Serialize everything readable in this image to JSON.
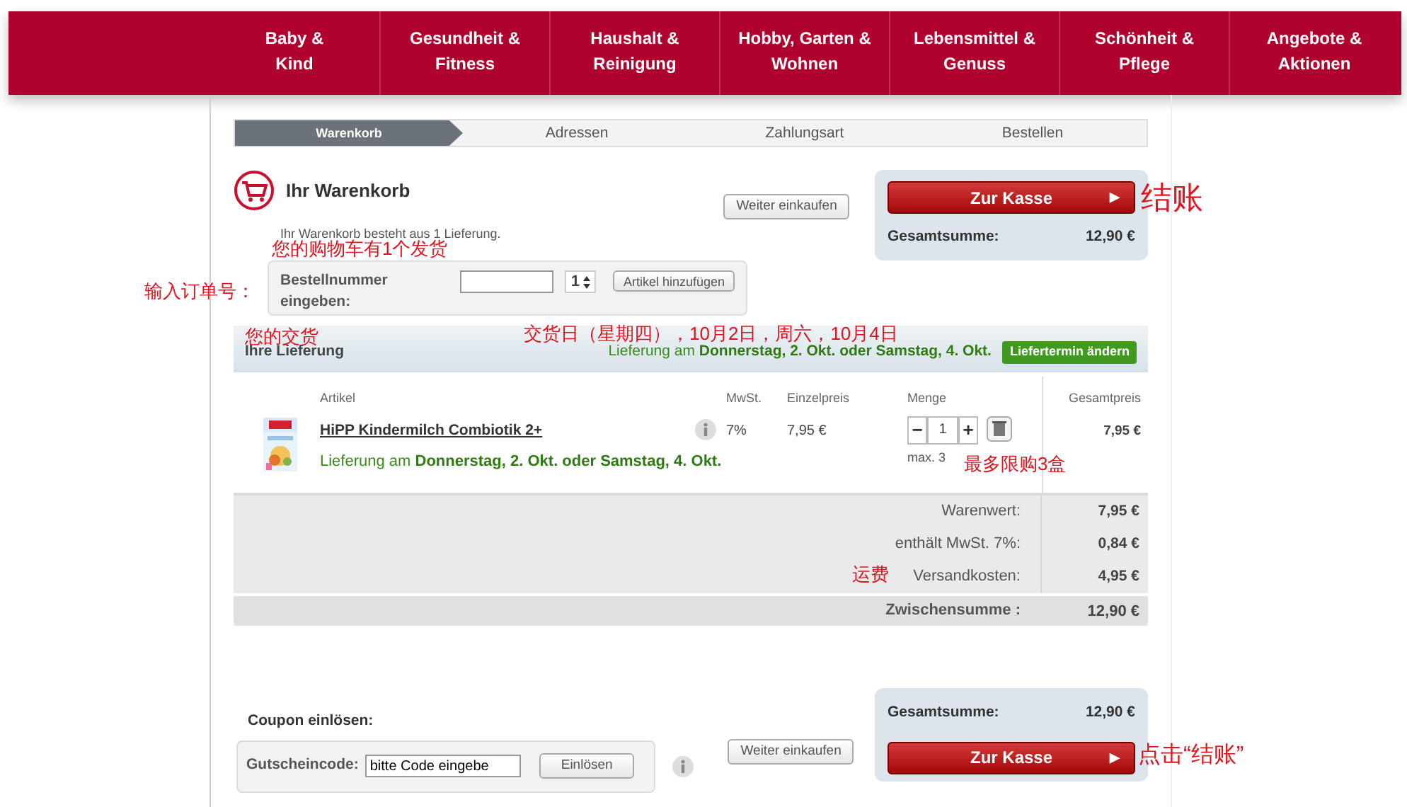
{
  "nav": {
    "items": [
      {
        "label": "Baby &\nKind"
      },
      {
        "label": "Gesundheit &\nFitness"
      },
      {
        "label": "Haushalt &\nReinigung"
      },
      {
        "label": "Hobby, Garten &\nWohnen"
      },
      {
        "label": "Lebensmittel &\nGenuss"
      },
      {
        "label": "Schönheit &\nPflege"
      },
      {
        "label": "Angebote &\nAktionen"
      }
    ]
  },
  "steps": [
    {
      "label": "Warenkorb",
      "selected": true
    },
    {
      "label": "Adressen",
      "selected": false
    },
    {
      "label": "Zahlungsart",
      "selected": false
    },
    {
      "label": "Bestellen",
      "selected": false
    }
  ],
  "cart": {
    "title": "Ihr Warenkorb",
    "subtitle": "Ihr Warenkorb besteht aus 1 Lieferung.",
    "continue_button": "Weiter einkaufen"
  },
  "checkout_top": {
    "button": "Zur Kasse",
    "button_arrow": "▶",
    "total_label": "Gesamtsumme:",
    "total_value": "12,90 €"
  },
  "order_number": {
    "label": "Bestellnummer eingeben:",
    "quantity": "1",
    "button": "Artikel hinzufügen"
  },
  "delivery": {
    "title": "Ihre Lieferung",
    "date_prefix": "Lieferung am ",
    "date": "Donnerstag, 2. Okt. oder Samstag, 4. Okt.",
    "change_button": "Liefertermin ändern"
  },
  "table": {
    "columns": [
      "Artikel",
      "MwSt.",
      "Einzelpreis",
      "Menge",
      "Gesamtpreis"
    ],
    "rows": [
      {
        "article": "HiPP Kindermilch Combiotik 2+",
        "delivery_prefix": "Lieferung am ",
        "delivery_date": "Donnerstag, 2. Okt. oder Samstag, 4. Okt.",
        "vat": "7%",
        "unit_price": "7,95 €",
        "minus": "−",
        "quantity": "1",
        "plus": "+",
        "max": "max. 3",
        "total": "7,95 €"
      }
    ]
  },
  "summary": {
    "rows": [
      {
        "label": "Warenwert:",
        "value": "7,95 €"
      },
      {
        "label": "enthält MwSt. 7%:",
        "value": "0,84 €"
      },
      {
        "label": "Versandkosten:",
        "value": "4,95 €"
      }
    ],
    "subtotal_label": "Zwischensumme :",
    "subtotal_value": "12,90 €"
  },
  "coupon": {
    "title": "Coupon einlösen:",
    "label": "Gutscheincode:",
    "value": "bitte Code eingebe",
    "button": "Einlösen",
    "continue_button": "Weiter einkaufen"
  },
  "checkout_bottom": {
    "total_label": "Gesamtsumme:",
    "total_value": "12,90 €",
    "button": "Zur Kasse",
    "button_arrow": "▶"
  },
  "annotations": [
    "结账",
    "您的购物车有1个发货",
    "输入订单号：",
    "您的交货",
    "交货日（星期四），10月2日，周六，10月4日",
    "最多限购3盒",
    "运费",
    "点击“结账”"
  ]
}
